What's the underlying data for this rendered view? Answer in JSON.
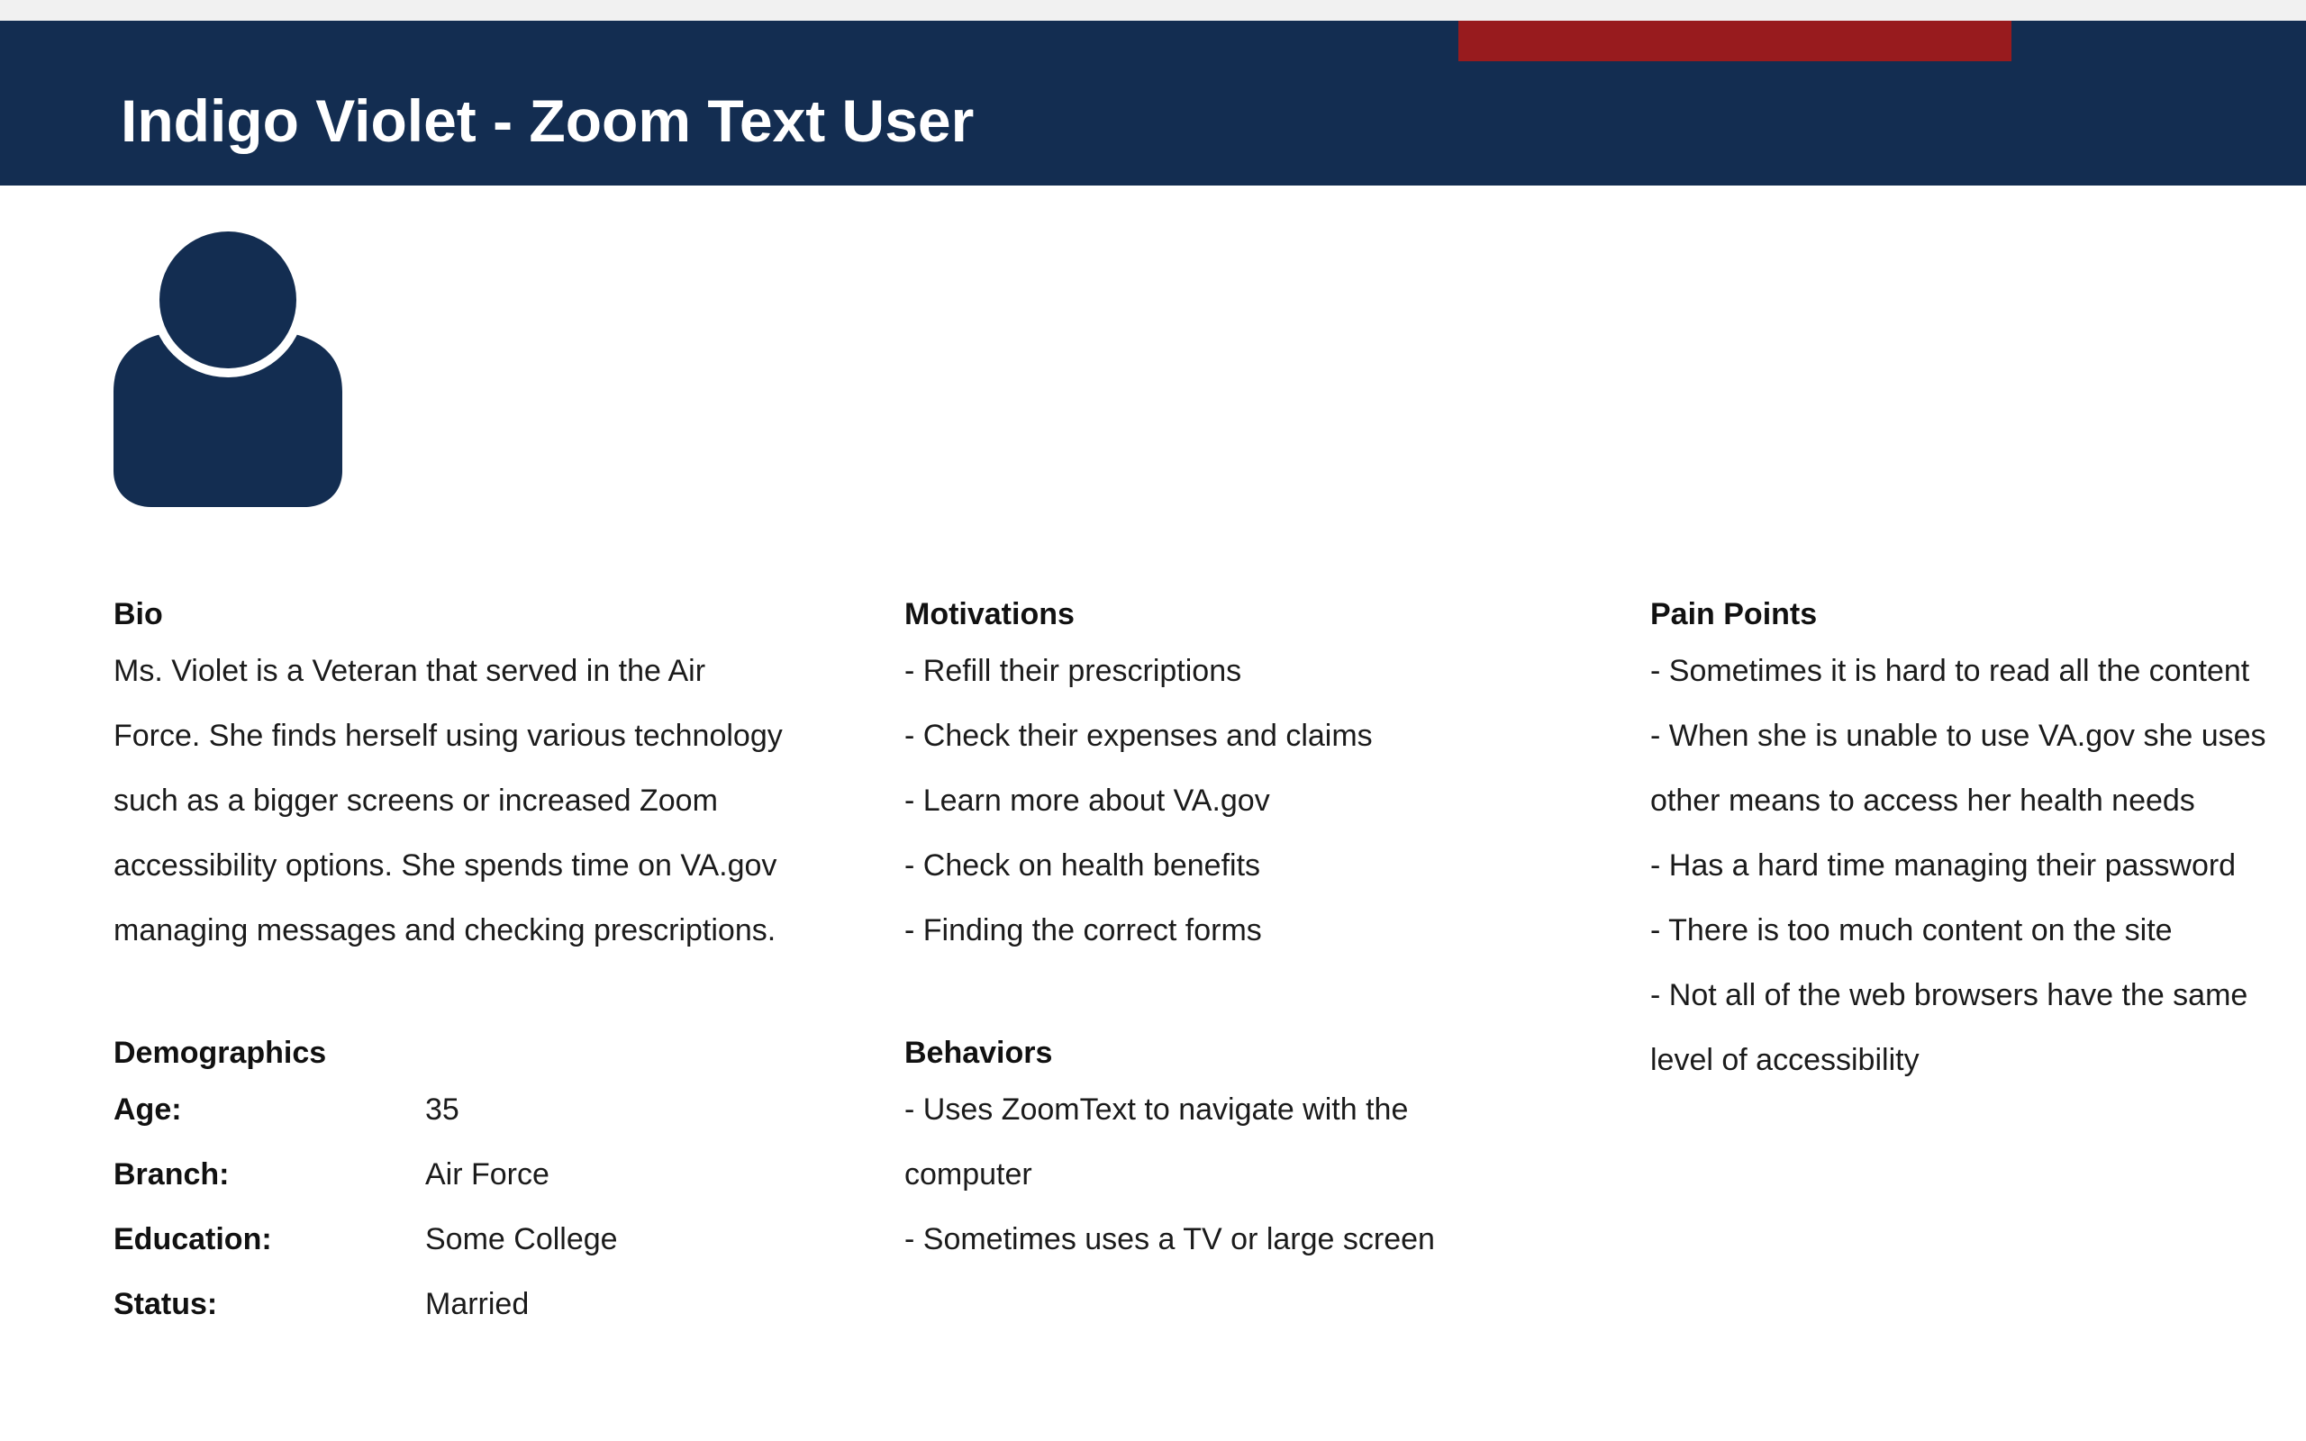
{
  "header": {
    "title": "Indigo Violet - Zoom Text User"
  },
  "avatar": {
    "icon": "user-avatar-icon",
    "color": "#132d51"
  },
  "colors": {
    "header_bg": "#132d51",
    "accent": "#981b1e",
    "top_strip": "#f1f1f1"
  },
  "bio": {
    "title": "Bio",
    "lines": [
      "Ms. Violet is a Veteran that served in the Air",
      "Force. She finds herself using various technology",
      "such as a bigger screens or increased Zoom",
      "accessibility options. She spends time on VA.gov",
      "managing messages and checking prescriptions."
    ]
  },
  "demographics": {
    "title": "Demographics",
    "rows": [
      {
        "label": "Age:",
        "value": "35"
      },
      {
        "label": "Branch:",
        "value": "Air Force"
      },
      {
        "label": "Education:",
        "value": "Some College"
      },
      {
        "label": "Status:",
        "value": "Married"
      }
    ]
  },
  "motivations": {
    "title": "Motivations",
    "items": [
      "- Refill their prescriptions",
      "- Check their expenses and claims",
      "- Learn more about VA.gov",
      "- Check on health benefits",
      "- Finding the correct forms"
    ]
  },
  "behaviors": {
    "title": "Behaviors",
    "lines": [
      "- Uses ZoomText to navigate with the",
      "computer",
      "- Sometimes uses a TV or large screen"
    ]
  },
  "pain_points": {
    "title": "Pain Points",
    "lines": [
      "- Sometimes it is hard to read all the content",
      "- When she is unable to use VA.gov she uses",
      "other means to access her health needs",
      "- Has a hard time managing their password",
      "- There is too much content on the site",
      "- Not all of the web browsers have the same",
      "level of accessibility"
    ]
  }
}
